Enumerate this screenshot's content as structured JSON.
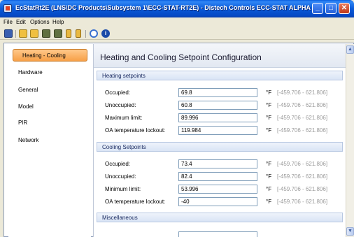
{
  "window": {
    "title": "EcStatRt2E (LNS\\DC Products\\Subsystem 1\\ECC-STAT-RT2E) - Distech Controls ECC-STAT ALPHA"
  },
  "menu": [
    "File",
    "Edit",
    "Options",
    "Help"
  ],
  "toolbar_icons": [
    "save-icon",
    "open-folder-icon",
    "open-folder-icon",
    "device-icon",
    "device-icon",
    "pin-icon",
    "pin-icon",
    "refresh-icon",
    "info-icon"
  ],
  "sidebar": {
    "items": [
      {
        "label": "Heating - Cooling",
        "active": true
      },
      {
        "label": "Hardware"
      },
      {
        "label": "General"
      },
      {
        "label": "Model"
      },
      {
        "label": "PIR"
      },
      {
        "label": "Network"
      }
    ]
  },
  "content": {
    "title": "Heating and Cooling Setpoint Configuration",
    "sections": [
      {
        "title": "Heating setpoints",
        "rows": [
          {
            "label": "Occupied:",
            "value": "69.8",
            "unit": "°F",
            "range": "[-459.706 - 621.806]"
          },
          {
            "label": "Unoccupied:",
            "value": "60.8",
            "unit": "°F",
            "range": "[-459.706 - 621.806]"
          },
          {
            "label": "Maximum limit:",
            "value": "89.996",
            "unit": "°F",
            "range": "[-459.706 - 621.806]"
          },
          {
            "label": "OA temperature lockout:",
            "value": "119.984",
            "unit": "°F",
            "range": "[-459.706 - 621.806]"
          }
        ]
      },
      {
        "title": "Cooling Setpoints",
        "rows": [
          {
            "label": "Occupied:",
            "value": "73.4",
            "unit": "°F",
            "range": "[-459.706 - 621.806]"
          },
          {
            "label": "Unoccupied:",
            "value": "82.4",
            "unit": "°F",
            "range": "[-459.706 - 621.806]"
          },
          {
            "label": "Minimum limit:",
            "value": "53.996",
            "unit": "°F",
            "range": "[-459.706 - 621.806]"
          },
          {
            "label": "OA temperature lockout:",
            "value": "-40",
            "unit": "°F",
            "range": "[-459.706 - 621.806]"
          }
        ]
      },
      {
        "title": "Miscellaneous",
        "rows": []
      }
    ]
  },
  "colors": {
    "titlebar": "#0a5ad8",
    "active_nav": "#f7a048",
    "section_bar": "#d9e4f5",
    "range_text": "#9a9a9a"
  }
}
